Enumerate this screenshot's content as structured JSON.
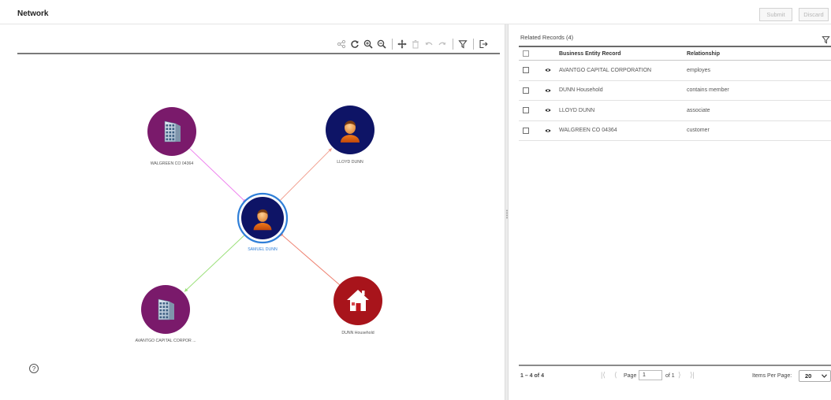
{
  "header": {
    "title": "Network",
    "submit_label": "Submit",
    "discard_label": "Discard"
  },
  "toolbar": {
    "tools": [
      "network-icon",
      "refresh-icon",
      "zoom-in-icon",
      "zoom-out-icon",
      "move-icon",
      "delete-icon",
      "undo-icon",
      "redo-icon",
      "filter-icon",
      "export-icon"
    ]
  },
  "graph": {
    "nodes": [
      {
        "id": "walgreen",
        "label": "WALGREEN CO 04364",
        "type": "organization",
        "color": "#7a1a6b"
      },
      {
        "id": "lloyd",
        "label": "LLOYD  DUNN",
        "type": "person",
        "color": "#0e1466"
      },
      {
        "id": "samuel",
        "label": "SAMUEL  DUNN",
        "type": "person",
        "color": "#0e1466",
        "selected": true
      },
      {
        "id": "avantgo",
        "label": "AVANTGO CAPITAL CORPOR ...",
        "type": "organization",
        "color": "#7a1a6b"
      },
      {
        "id": "dunnhh",
        "label": "DUNN Household",
        "type": "household",
        "color": "#a8141b"
      }
    ],
    "edges": [
      {
        "from": "walgreen",
        "to": "samuel",
        "color": "#ee82ee"
      },
      {
        "from": "samuel",
        "to": "lloyd",
        "color": "#f2a090"
      },
      {
        "from": "samuel",
        "to": "avantgo",
        "color": "#9be07a"
      },
      {
        "from": "dunnhh",
        "to": "samuel",
        "color": "#ee8070"
      }
    ],
    "help_label": "?"
  },
  "related": {
    "title": "Related Records (4)",
    "columns": {
      "record": "Business Entity Record",
      "relationship": "Relationship"
    },
    "rows": [
      {
        "record": "AVANTGO CAPITAL CORPORATION",
        "relationship": "employes"
      },
      {
        "record": "DUNN Household",
        "relationship": "contains member"
      },
      {
        "record": "LLOYD DUNN",
        "relationship": "associate"
      },
      {
        "record": "WALGREEN CO 04364",
        "relationship": "customer"
      }
    ]
  },
  "pager": {
    "count": "1 – 4 of 4",
    "page_label": "Page",
    "page_value": "1",
    "of_label": "of 1",
    "items_per_page_label": "Items Per Page:",
    "items_per_page_value": "20"
  },
  "colors": {
    "accent": "#2f7fd8",
    "org": "#7a1a6b",
    "person": "#0e1466",
    "household": "#a8141b"
  }
}
